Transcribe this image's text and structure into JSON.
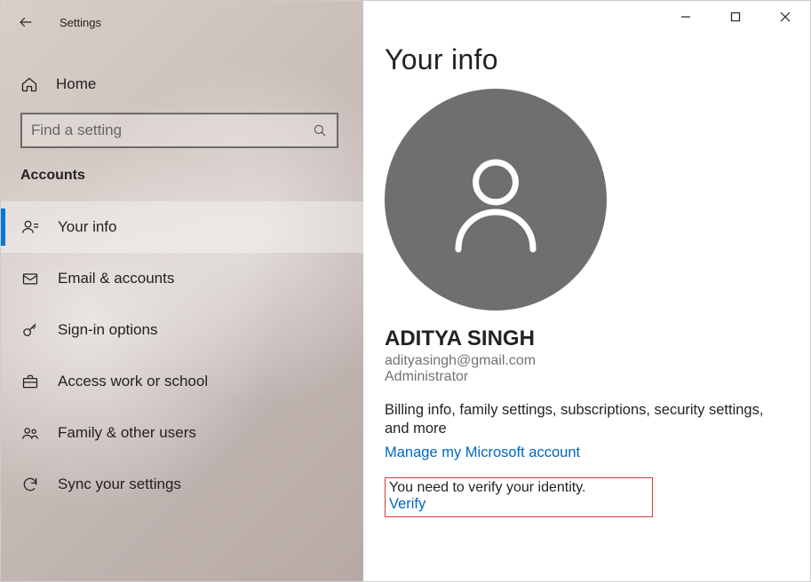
{
  "titlebar": {
    "app_title": "Settings"
  },
  "nav": {
    "home_label": "Home",
    "search_placeholder": "Find a setting",
    "section": "Accounts",
    "items": [
      {
        "label": "Your info"
      },
      {
        "label": "Email & accounts"
      },
      {
        "label": "Sign-in options"
      },
      {
        "label": "Access work or school"
      },
      {
        "label": "Family & other users"
      },
      {
        "label": "Sync your settings"
      }
    ]
  },
  "page": {
    "heading": "Your info",
    "user_name": "ADITYA SINGH",
    "user_email": "adityasingh@gmail.com",
    "user_role": "Administrator",
    "description": "Billing info, family settings, subscriptions, security settings, and more",
    "manage_link": "Manage my Microsoft account",
    "verify_msg": "You need to verify your identity.",
    "verify_link": "Verify"
  }
}
